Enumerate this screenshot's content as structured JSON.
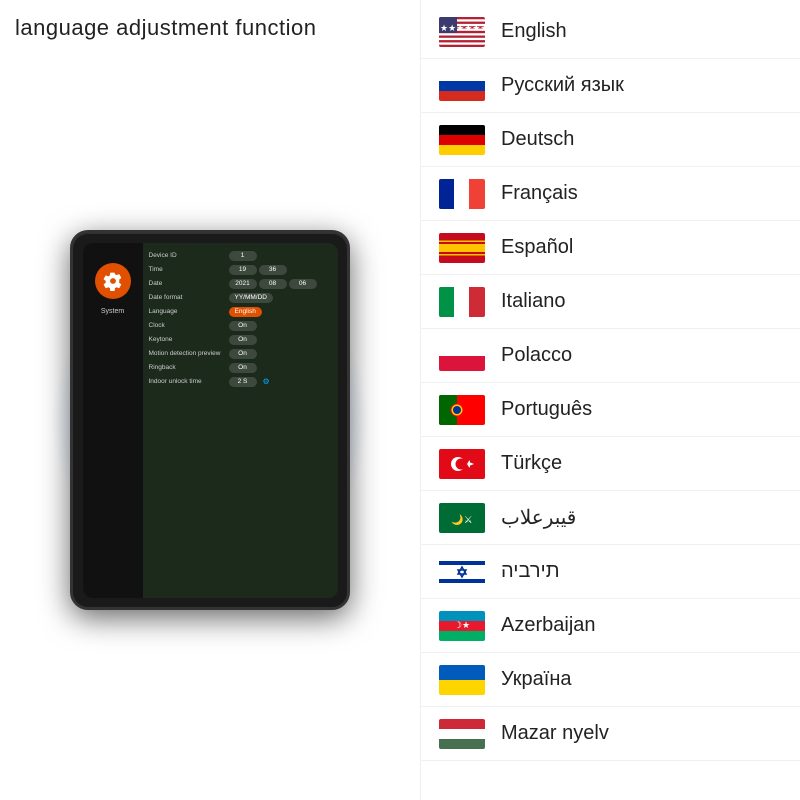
{
  "page": {
    "title": "language adjustment function"
  },
  "tablet": {
    "sidebar": {
      "icon_label": "System"
    },
    "rows": [
      {
        "label": "Device ID",
        "values": [
          "1"
        ]
      },
      {
        "label": "Time",
        "values": [
          "19",
          "36"
        ]
      },
      {
        "label": "Date",
        "values": [
          "2021",
          "08",
          "06"
        ]
      },
      {
        "label": "Date format",
        "values": [
          "YY/MM/DD"
        ]
      },
      {
        "label": "Language",
        "values": [
          "English"
        ],
        "highlight": true
      },
      {
        "label": "Clock",
        "values": [
          "On"
        ]
      },
      {
        "label": "Keytone",
        "values": [
          "On"
        ]
      },
      {
        "label": "Motion detection preview",
        "values": [
          "On"
        ]
      },
      {
        "label": "Ringback",
        "values": [
          "On"
        ]
      },
      {
        "label": "Indoor unlock time",
        "values": [
          "2 S"
        ]
      }
    ]
  },
  "languages": [
    {
      "name": "English",
      "flag": "us"
    },
    {
      "name": "Русский язык",
      "flag": "ru"
    },
    {
      "name": "Deutsch",
      "flag": "de"
    },
    {
      "name": "Français",
      "flag": "fr"
    },
    {
      "name": "Español",
      "flag": "es"
    },
    {
      "name": "Italiano",
      "flag": "it"
    },
    {
      "name": "Polacco",
      "flag": "pl"
    },
    {
      "name": "Português",
      "flag": "pt"
    },
    {
      "name": "Türkçe",
      "flag": "tr"
    },
    {
      "name": "قيبرعلاب",
      "flag": "sa"
    },
    {
      "name": "תירביה",
      "flag": "il"
    },
    {
      "name": "Azerbaijan",
      "flag": "az"
    },
    {
      "name": "Україна",
      "flag": "ua"
    },
    {
      "name": "Mazar nyelv",
      "flag": "hu"
    }
  ]
}
